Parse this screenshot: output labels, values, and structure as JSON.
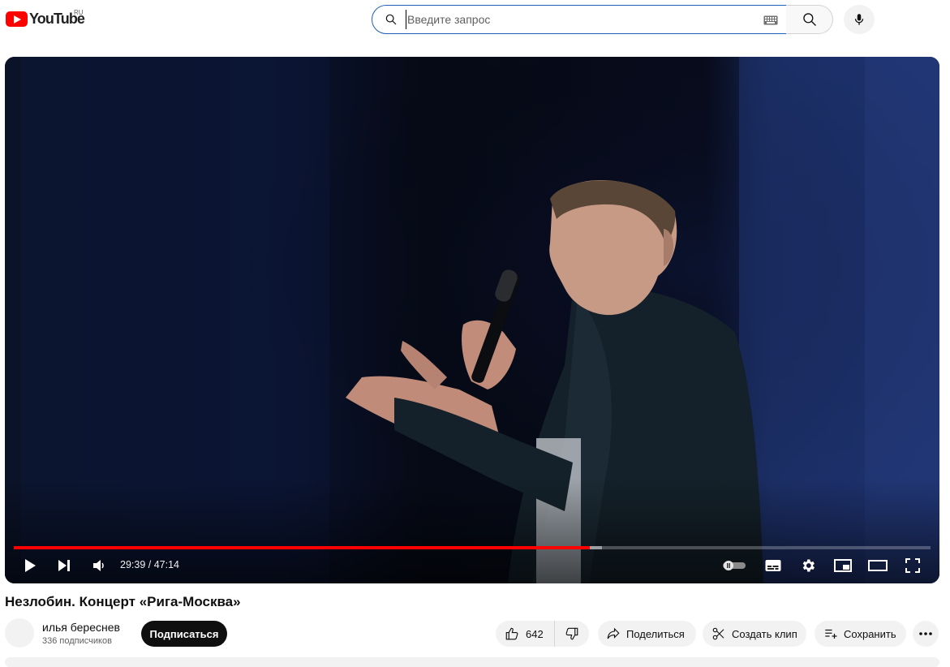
{
  "masthead": {
    "logo_text": "YouTube",
    "region": "RU",
    "search_placeholder": "Введите запрос",
    "search_value": "",
    "icons": [
      "youtube-logo-icon",
      "search-icon",
      "keyboard-icon",
      "mic-icon"
    ]
  },
  "player": {
    "time_display": "29:39 / 47:14",
    "progress_fraction": 0.628,
    "buffered_fraction": 0.642,
    "progress_color": "#ff0000",
    "controls": [
      "play-icon",
      "next-icon",
      "volume-icon",
      "autoplay-toggle",
      "subtitles-icon",
      "settings-icon",
      "miniplayer-icon",
      "theater-icon",
      "fullscreen-icon"
    ]
  },
  "video": {
    "title": "Незлобин. Концерт «Рига-Москва»"
  },
  "channel": {
    "name": "илья береснев",
    "subscribers": "336 подписчиков",
    "subscribe_label": "Подписаться"
  },
  "actions": {
    "likes": "642",
    "share_label": "Поделиться",
    "clip_label": "Создать клип",
    "save_label": "Сохранить"
  },
  "colors": {
    "brand": "#ff0000",
    "search_border": "#1c62b9",
    "pill_bg": "#f2f2f2"
  }
}
